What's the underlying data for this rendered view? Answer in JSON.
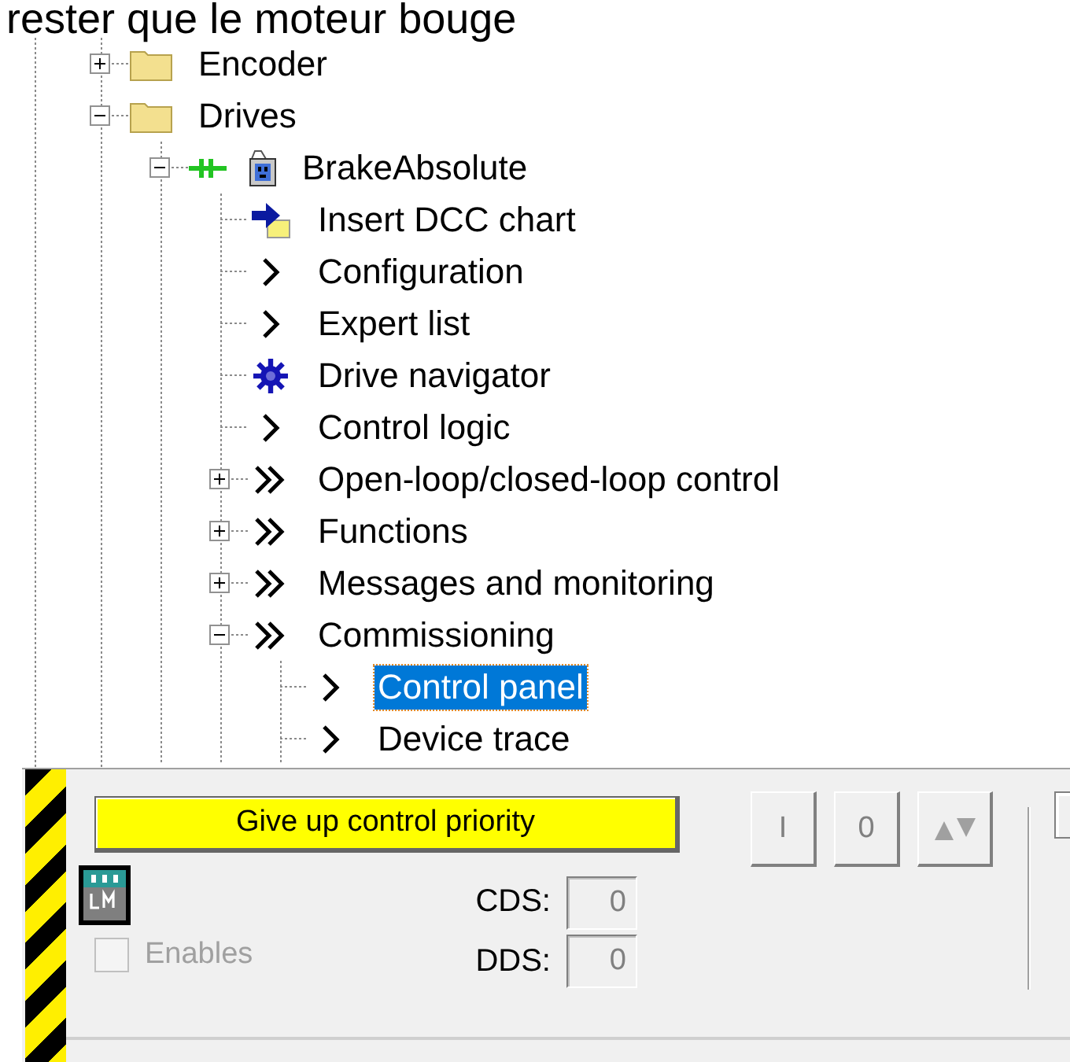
{
  "caption": {
    "text": "rester que le moteur bouge"
  },
  "tree": [
    {
      "label": "Encoder",
      "kind": "folder",
      "expanded": false,
      "selected": false
    },
    {
      "label": "Drives",
      "kind": "folder",
      "expanded": true,
      "selected": false,
      "children": [
        {
          "label": "BrakeAbsolute",
          "kind": "drive",
          "expanded": true,
          "selected": false,
          "children": [
            {
              "label": "Insert DCC chart",
              "kind": "chart",
              "selected": false
            },
            {
              "label": "Configuration",
              "kind": "chevron",
              "selected": false
            },
            {
              "label": "Expert list",
              "kind": "chevron",
              "selected": false
            },
            {
              "label": "Drive navigator",
              "kind": "navigator",
              "selected": false
            },
            {
              "label": "Control logic",
              "kind": "chevron",
              "selected": false
            },
            {
              "label": "Open-loop/closed-loop control",
              "kind": "double-chevron",
              "expanded": false,
              "selected": false
            },
            {
              "label": "Functions",
              "kind": "double-chevron",
              "expanded": false,
              "selected": false
            },
            {
              "label": "Messages and monitoring",
              "kind": "double-chevron",
              "expanded": false,
              "selected": false
            },
            {
              "label": "Commissioning",
              "kind": "double-chevron",
              "expanded": true,
              "selected": false,
              "children": [
                {
                  "label": "Control panel",
                  "kind": "chevron",
                  "selected": true
                },
                {
                  "label": "Device trace",
                  "kind": "chevron",
                  "selected": false
                }
              ]
            }
          ]
        }
      ]
    }
  ],
  "control_panel": {
    "priority_button": "Give up control priority",
    "command_buttons": [
      {
        "kind": "text",
        "label": "I"
      },
      {
        "kind": "text",
        "label": "0"
      },
      {
        "kind": "arrows"
      }
    ],
    "enables": {
      "label": "Enables",
      "checked": false,
      "disabled": true
    },
    "cds": {
      "label": "CDS:",
      "value": "0"
    },
    "dds": {
      "label": "DDS:",
      "value": "0"
    }
  }
}
